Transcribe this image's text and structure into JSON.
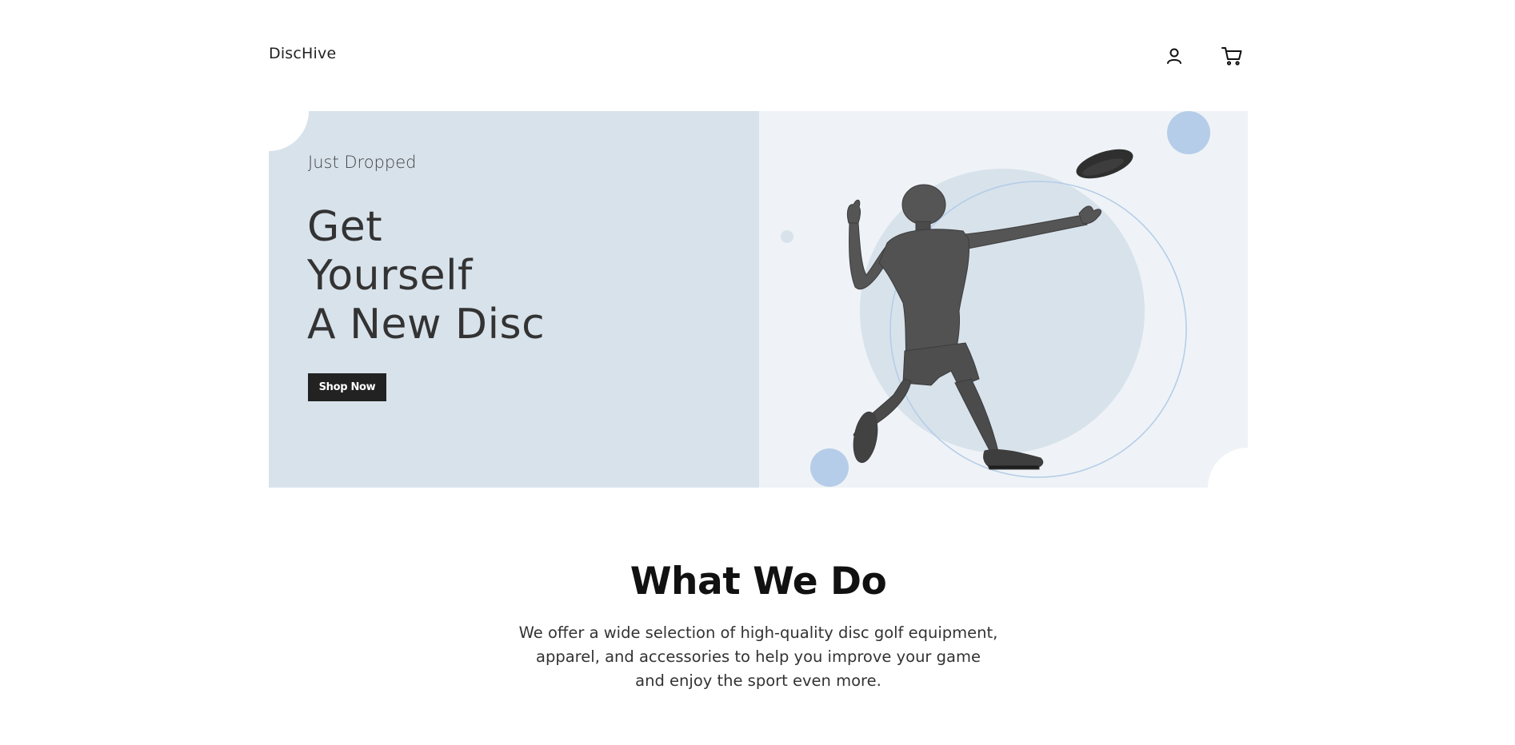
{
  "header": {
    "brand": "DiscHive",
    "icons": {
      "account": "user-icon",
      "cart": "cart-icon"
    }
  },
  "hero": {
    "eyebrow": "Just Dropped",
    "headline": [
      "Get",
      "Yourself",
      "A New Disc"
    ],
    "cta_label": "Shop Now",
    "illustration": "disc-golf-player-illustration",
    "colors": {
      "left_panel": "#d8e2eb",
      "right_panel": "#eff3f7",
      "accent_circle": "#b5cde8",
      "button": "#222222"
    }
  },
  "about": {
    "title": "What We Do",
    "lines": [
      "We offer a wide selection of high-quality disc golf equipment,",
      "apparel, and accessories to help you improve your game",
      "and enjoy the sport even more."
    ]
  }
}
